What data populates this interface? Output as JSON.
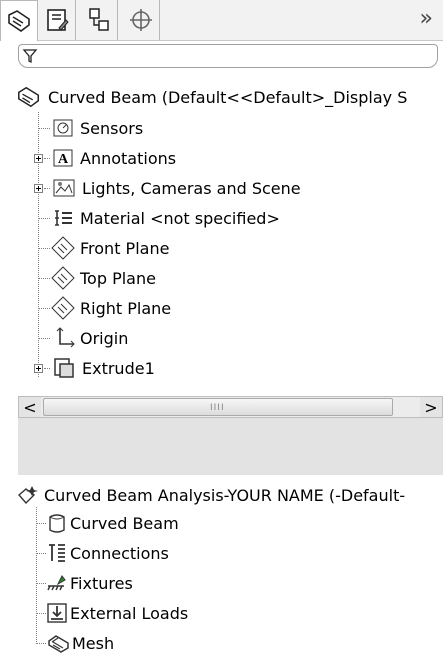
{
  "tabs": [
    {
      "name": "feature-manager-tab",
      "icon": "feature-manager-icon",
      "active": true
    },
    {
      "name": "property-manager-tab",
      "icon": "property-manager-icon",
      "active": false
    },
    {
      "name": "configuration-manager-tab",
      "icon": "configuration-manager-icon",
      "active": false
    },
    {
      "name": "dimxpert-manager-tab",
      "icon": "dimxpert-icon",
      "active": false
    }
  ],
  "more_tabs_label": "»",
  "feature_tree": {
    "root_label": "Curved Beam  (Default<<Default>_Display S",
    "items": [
      {
        "label": "Sensors",
        "icon": "sensors-icon",
        "expandable": false
      },
      {
        "label": "Annotations",
        "icon": "annotations-icon",
        "expandable": true
      },
      {
        "label": "Lights, Cameras and Scene",
        "icon": "lights-cameras-icon",
        "expandable": true
      },
      {
        "label": "Material <not specified>",
        "icon": "material-icon",
        "expandable": false
      },
      {
        "label": "Front Plane",
        "icon": "plane-icon",
        "expandable": false
      },
      {
        "label": "Top Plane",
        "icon": "plane-icon",
        "expandable": false
      },
      {
        "label": "Right Plane",
        "icon": "plane-icon",
        "expandable": false
      },
      {
        "label": "Origin",
        "icon": "origin-icon",
        "expandable": false
      },
      {
        "label": "Extrude1",
        "icon": "extrude-icon",
        "expandable": true
      }
    ]
  },
  "scrollbar": {
    "left_arrow": "<",
    "right_arrow": ">",
    "grip": "IIII"
  },
  "study_tree": {
    "root_label": "Curved Beam Analysis-YOUR NAME (-Default-",
    "items": [
      {
        "label": "Curved Beam",
        "icon": "part-icon"
      },
      {
        "label": "Connections",
        "icon": "connections-icon"
      },
      {
        "label": "Fixtures",
        "icon": "fixtures-icon"
      },
      {
        "label": "External Loads",
        "icon": "external-loads-icon"
      },
      {
        "label": "Mesh",
        "icon": "mesh-icon"
      }
    ]
  }
}
